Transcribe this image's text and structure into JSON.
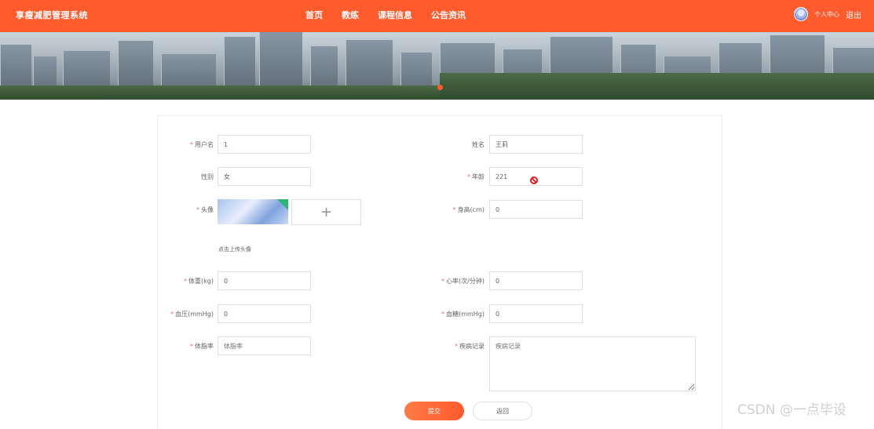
{
  "header": {
    "brand": "享瘦减肥管理系统",
    "nav": [
      "首页",
      "教练",
      "课程信息",
      "公告资讯"
    ],
    "user_center": "个人中心",
    "logout": "退出"
  },
  "form": {
    "username": {
      "label": "用户名",
      "value": "1"
    },
    "name": {
      "label": "姓名",
      "value": "王莉"
    },
    "gender": {
      "label": "性别",
      "value": "女"
    },
    "age": {
      "label": "年龄",
      "value": "221"
    },
    "avatar": {
      "label": "头像",
      "hint": "点击上传头像"
    },
    "height": {
      "label": "身高(cm)",
      "value": "0"
    },
    "weight": {
      "label": "体重(kg)",
      "value": "0"
    },
    "heart_rate": {
      "label": "心率(次/分钟)",
      "value": "0"
    },
    "blood_pressure": {
      "label": "血压(mmHg)",
      "value": "0"
    },
    "blood_sugar": {
      "label": "血糖(mmHg)",
      "value": "0"
    },
    "body_fat": {
      "label": "体脂率",
      "placeholder": "体脂率"
    },
    "disease": {
      "label": "疾病记录",
      "placeholder": "疾病记录"
    }
  },
  "buttons": {
    "submit": "提交",
    "back": "返回"
  },
  "watermark": "CSDN @一点毕设",
  "colors": {
    "accent": "#ff5b2d",
    "required": "#f56c6c"
  }
}
